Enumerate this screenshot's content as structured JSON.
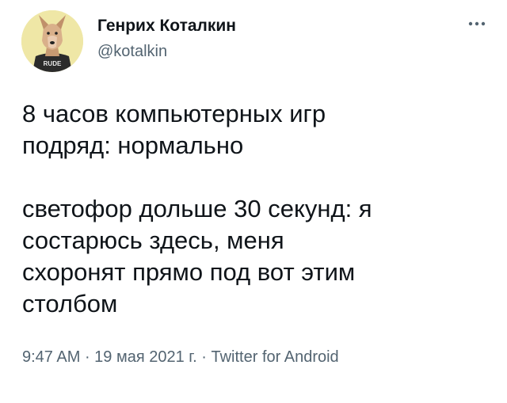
{
  "author": {
    "display_name": "Генрих Коталкин",
    "username": "@kotalkin",
    "avatar_icon": "dog-avatar-icon",
    "avatar_shirt_text": "RUDE",
    "avatar_bg_color": "#efe7a6"
  },
  "more_icon": "more-horizontal-icon",
  "tweet": {
    "text": "8 часов компьютерных игр\nподряд: нормально\n\nсветофор дольше 30 секунд: я\nсостарюсь здесь, меня\nсхоронят прямо под вот этим\nстолбом"
  },
  "meta": {
    "time": "9:47 AM",
    "separator_1": " · ",
    "date": "19 мая 2021 г.",
    "separator_2": " · ",
    "source": "Twitter for Android"
  },
  "colors": {
    "text_primary": "#0f1419",
    "text_secondary": "#536471"
  }
}
